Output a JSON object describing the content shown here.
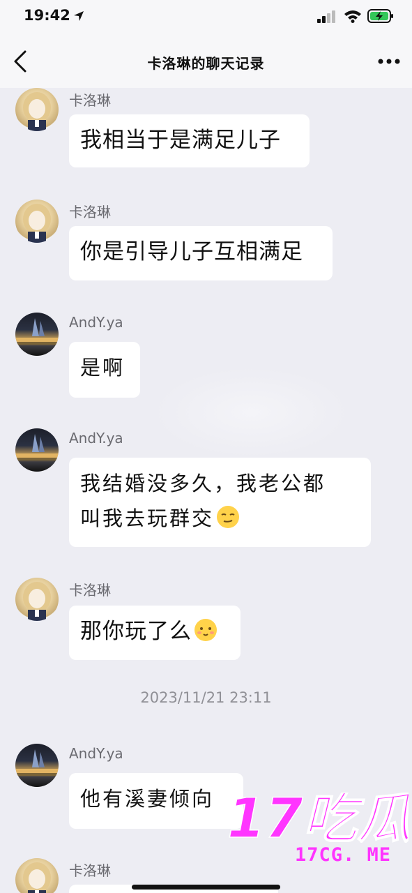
{
  "status_bar": {
    "time": "19:42",
    "icons": [
      "location-arrow-icon",
      "cellular-signal-icon",
      "wifi-icon",
      "battery-charging-icon"
    ]
  },
  "nav": {
    "title": "卡洛琳的聊天记录",
    "back_icon": "chevron-left-icon",
    "more_icon": "more-dots-icon"
  },
  "messages": [
    {
      "sender": "卡洛琳",
      "avatar": "girl-avatar",
      "text": "我相当于是满足儿子"
    },
    {
      "sender": "卡洛琳",
      "avatar": "girl-avatar",
      "text": "你是引导儿子互相满足"
    },
    {
      "sender": "AndY.ya",
      "avatar": "city-avatar",
      "text": "是啊"
    },
    {
      "sender": "AndY.ya",
      "avatar": "city-avatar",
      "text_line1": "我结婚没多久，我老公都",
      "text_line2": "叫我去玩群交",
      "emoji": "smirk-emoji"
    },
    {
      "sender": "卡洛琳",
      "avatar": "girl-avatar",
      "text": "那你玩了么",
      "emoji": "blush-emoji"
    },
    {
      "sender": "AndY.ya",
      "avatar": "city-avatar",
      "text": "他有溪妻倾向"
    },
    {
      "sender": "卡洛琳",
      "avatar": "girl-avatar"
    }
  ],
  "timestamp": "2023/11/21 23:11",
  "watermark": {
    "logo_text": "17吃瓜",
    "site": "17CG. ME",
    "color": "#ff35ff"
  },
  "colors": {
    "background": "#ededf3",
    "bubble": "#ffffff",
    "bar": "#f7f7f9"
  }
}
